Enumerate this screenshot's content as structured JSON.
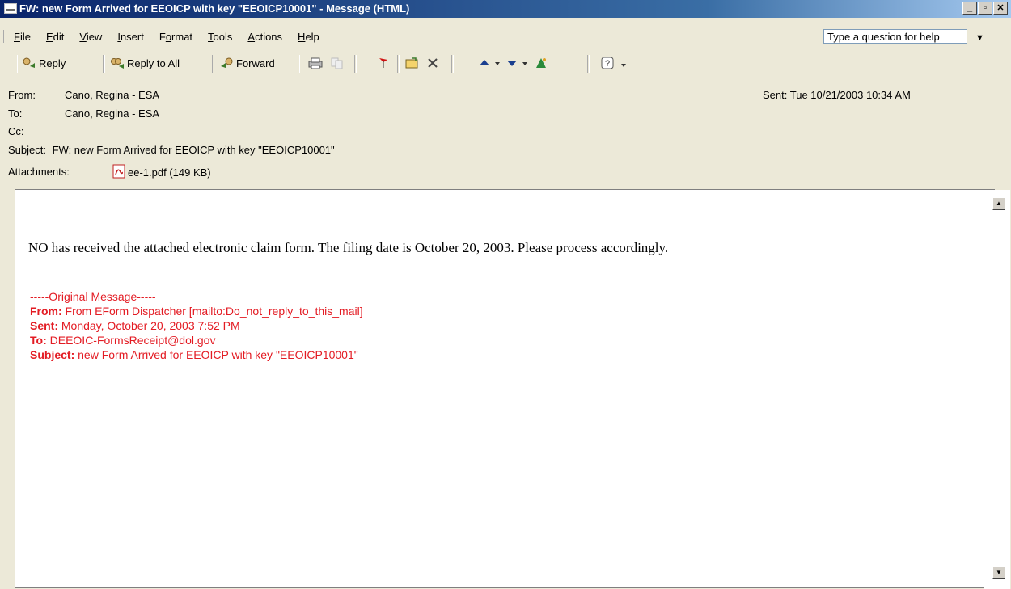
{
  "window": {
    "title": "FW: new Form Arrived for EEOICP with key \"EEOICP10001\" - Message (HTML)",
    "controls": [
      "_",
      "▫",
      "✕"
    ]
  },
  "menu": {
    "items": [
      {
        "u": "F",
        "rest": "ile"
      },
      {
        "u": "E",
        "rest": "dit"
      },
      {
        "u": "V",
        "rest": "iew"
      },
      {
        "u": "I",
        "rest": "nsert"
      },
      {
        "pre": "F",
        "u": "o",
        "rest": "rmat"
      },
      {
        "u": "T",
        "rest": "ools"
      },
      {
        "u": "A",
        "rest": "ctions"
      },
      {
        "u": "H",
        "rest": "elp"
      }
    ],
    "help_placeholder": "Type a question for help"
  },
  "toolbar": {
    "reply": "Reply",
    "reply_all": "Reply to All",
    "forward": "Forward"
  },
  "header": {
    "from_label": "From:",
    "from": "Cano, Regina - ESA",
    "to_label": "To:",
    "to": "Cano, Regina - ESA",
    "cc_label": "Cc:",
    "cc": "",
    "subject_label": "Subject:",
    "subject": "FW: new Form Arrived for EEOICP with key \"EEOICP10001\"",
    "sent_label": "Sent:",
    "sent": "Tue 10/21/2003 10:34 AM",
    "attachments_label": "Attachments:",
    "attachment": "ee-1.pdf (149 KB)"
  },
  "message": {
    "body": "NO has received the attached electronic claim form.  The filing date is October 20, 2003.  Please process accordingly.",
    "original_header": "-----Original Message-----",
    "orig_from_label": "From:",
    "orig_from": " From EForm Dispatcher [mailto:Do_not_reply_to_this_mail]",
    "orig_sent_label": "Sent:",
    "orig_sent": " Monday, October 20, 2003 7:52 PM",
    "orig_to_label": "To:",
    "orig_to": " DEEOIC-FormsReceipt@dol.gov",
    "orig_subject_label": "Subject:",
    "orig_subject": " new Form Arrived for EEOICP with key \"EEOICP10001\""
  },
  "colors": {
    "title_bar": "#0a246a",
    "chrome": "#ece9d8",
    "original_message_red": "#e31b23"
  }
}
